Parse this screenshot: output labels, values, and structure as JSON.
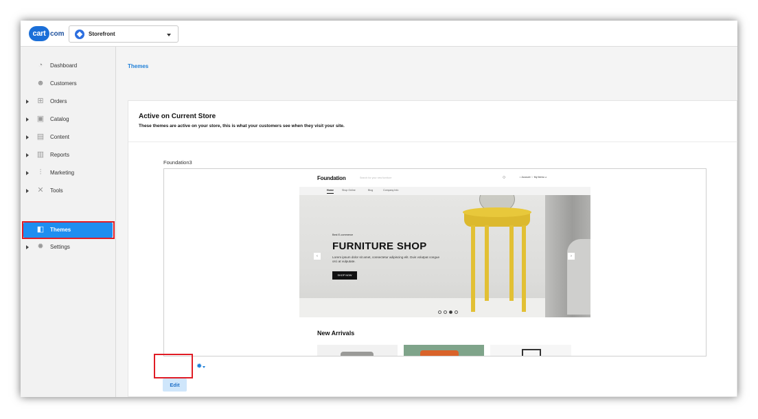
{
  "header": {
    "logo": "cart.com",
    "store_selector": {
      "value": "Storefront"
    }
  },
  "sidebar": {
    "items": [
      {
        "label": "Dashboard",
        "icon": "dashboard-icon"
      },
      {
        "label": "Customers",
        "icon": "customers-icon"
      },
      {
        "label": "Orders",
        "icon": "cart-icon"
      },
      {
        "label": "Catalog",
        "icon": "catalog-icon"
      },
      {
        "label": "Content",
        "icon": "content-icon"
      },
      {
        "label": "Reports",
        "icon": "reports-icon"
      },
      {
        "label": "Marketing",
        "icon": "marketing-icon"
      },
      {
        "label": "Tools",
        "icon": "tools-icon"
      },
      {
        "label": "Themes",
        "icon": "themes-icon",
        "active": true
      },
      {
        "label": "Settings",
        "icon": "settings-icon"
      }
    ]
  },
  "breadcrumb": "Themes",
  "card": {
    "title": "Active on Current Store",
    "subtitle": "These themes are active on your store, this is what your customers see when they visit your site.",
    "theme_name": "Foundation3",
    "edit_label": "Edit"
  },
  "preview": {
    "brand": "Foundation",
    "search_placeholder": "Search for your new furniture",
    "account": "Account",
    "wishlist": "My Items",
    "nav": [
      "Home",
      "Shop Online",
      "Blog",
      "Company Info"
    ],
    "hero": {
      "kicker": "Best E-commerce",
      "title": "FURNITURE SHOP",
      "body": "Lorem ipsum dolor sit amet, consectetur adipiscing elit. Duis volutpat congue orci at vulputate.",
      "button": "SHOP NOW"
    },
    "section_title": "New Arrivals"
  },
  "colors": {
    "accent": "#1e8ef0",
    "highlight": "#e01b24"
  }
}
